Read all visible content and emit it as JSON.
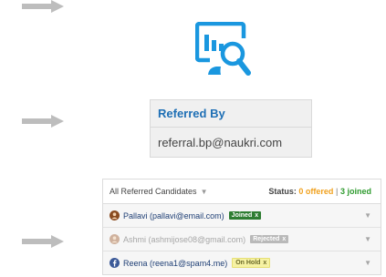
{
  "icons": {
    "arrow": "right-arrow-icon",
    "analytics": "analytics-search-icon"
  },
  "colors": {
    "accent": "#1a97df",
    "arrow": "#bdbdbd",
    "joined": "#2e7d32",
    "offered": "#f0a11e"
  },
  "referral": {
    "heading": "Referred By",
    "email": "referral.bp@naukri.com"
  },
  "candidates": {
    "title": "All Referred Candidates",
    "status_label": "Status:",
    "offered": "0 offered",
    "separator": "|",
    "joined": "3 joined",
    "rows": [
      {
        "name": "Pallavi (pallavi@email.com)",
        "status": "Joined",
        "remove": "x"
      },
      {
        "name": "Ashmi (ashmijose08@gmail.com)",
        "status": "Rejected",
        "remove": "x"
      },
      {
        "name": "Reena (reena1@spam4.me)",
        "status": "On Hold",
        "remove": "x"
      }
    ]
  }
}
